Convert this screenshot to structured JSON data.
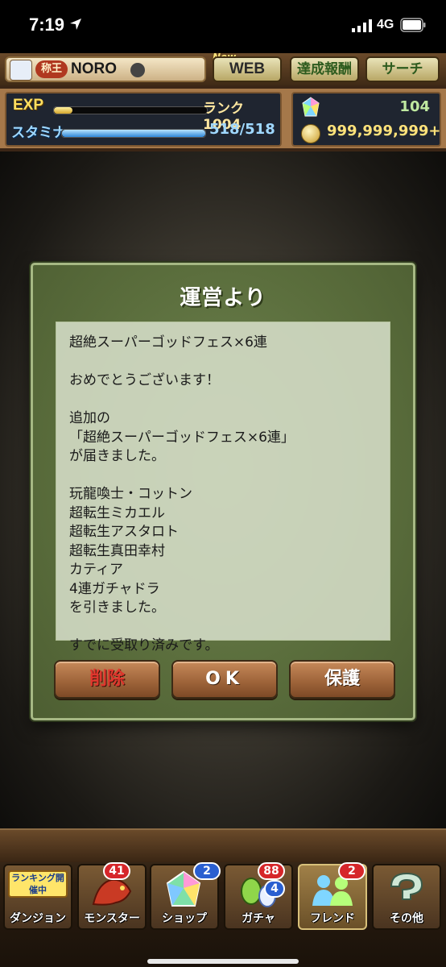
{
  "status_bar": {
    "time": "7:19",
    "network": "4G"
  },
  "header": {
    "player": {
      "title_badge": "称王",
      "name": "NORO"
    },
    "buttons": {
      "new_tag": "New",
      "web": "WEB",
      "achievements": "達成報酬",
      "search": "サーチ"
    },
    "exp": {
      "label": "EXP",
      "rank_text": "ランク1004",
      "progress": 0.12
    },
    "stamina": {
      "label": "スタミナ",
      "value": "518/518",
      "progress": 1.0
    },
    "magic_stones": "104",
    "coins": "999,999,999+"
  },
  "dialog": {
    "title": "運営より",
    "message_lines": [
      "超絶スーパーゴッドフェス×6連",
      "",
      "おめでとうございます！",
      "",
      "追加の",
      "「超絶スーパーゴッドフェス×6連」",
      "が届きました。",
      "",
      "玩龍喚士・コットン",
      "超転生ミカエル",
      "超転生アスタロト",
      "超転生真田幸村",
      "カティア",
      "4連ガチャドラ",
      "を引きました。",
      "",
      "すでに受取り済みです。"
    ],
    "buttons": {
      "delete": "削除",
      "ok": "OK",
      "protect": "保護"
    }
  },
  "bottom_nav": {
    "ranking_banner": "ランキング開催中",
    "items": [
      {
        "label": "ダンジョン",
        "badge": ""
      },
      {
        "label": "モンスター",
        "badge": "41"
      },
      {
        "label": "ショップ",
        "badge": "2"
      },
      {
        "label": "ガチャ",
        "badge": "88",
        "badge2": "4"
      },
      {
        "label": "フレンド",
        "badge": "2"
      },
      {
        "label": "その他",
        "badge": ""
      }
    ]
  },
  "colors": {
    "dialog_bg": "#5a6d3c",
    "delete_text": "#e0362d",
    "badge_red": "#d6262a",
    "badge_blue": "#2a5fd0"
  }
}
